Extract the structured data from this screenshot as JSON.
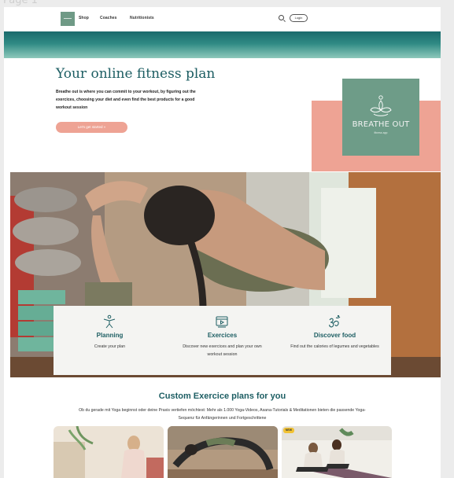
{
  "canvas_label": "Page 1",
  "nav": {
    "links": [
      "Shop",
      "Coaches",
      "Nutritionists"
    ],
    "login_label": "Login"
  },
  "hero": {
    "title": "Your online fitness plan",
    "description": "Breathe out is where you can commit to your workout, by figuring out the exercices, choosing your diet and even find the best products for a good workout session",
    "cta_label": "Let's get started »"
  },
  "brand": {
    "name": "BREATHE OUT",
    "tagline": "fitness app"
  },
  "features": [
    {
      "icon": "person-stretch-icon",
      "title": "Planning",
      "description": "Create your plan"
    },
    {
      "icon": "video-playlist-icon",
      "title": "Exercices",
      "description": "Discover new exercices and plan your own workout session"
    },
    {
      "icon": "om-symbol-icon",
      "title": "Discover food",
      "description": "Find out the calories of legumes and vegetables"
    }
  ],
  "plans": {
    "title": "Custom Exercice plans for you",
    "description": "Ob du gerade mit Yoga beginnst oder deine Praxis vertiefen möchtest: Mehr als 1.000 Yoga-Videos, Asana-Tutorials & Meditationen bieten die passende Yoga-Sequenz für Anfängerinnen und Fortgeschrittene",
    "thumbnails": [
      {
        "badge": ""
      },
      {
        "badge": ""
      },
      {
        "badge": "NEW"
      }
    ]
  },
  "colors": {
    "primary": "#1d5e63",
    "accent": "#eea394",
    "brand_green": "#6e9c88"
  }
}
